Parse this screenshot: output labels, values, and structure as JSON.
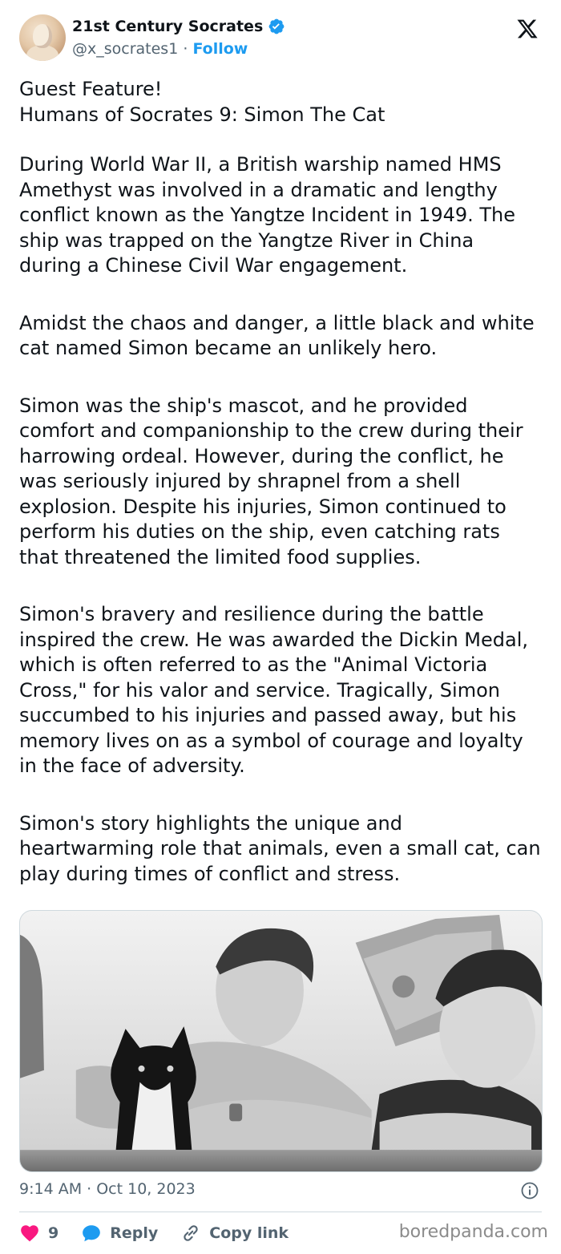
{
  "author": {
    "name": "21st Century Socrates",
    "handle": "@x_socrates1",
    "separator": "·",
    "follow_label": "Follow"
  },
  "post": {
    "paragraphs": [
      "Guest Feature!\nHumans of Socrates 9: Simon The Cat",
      "During World War II, a British warship named HMS Amethyst was involved in a dramatic and lengthy conflict known as the Yangtze Incident in 1949. The ship was trapped on the Yangtze River in China during a Chinese Civil War engagement.",
      "Amidst the chaos and danger, a little black and white cat named Simon became an unlikely hero.",
      "Simon was the ship's mascot, and he provided comfort and companionship to the crew during their harrowing ordeal. However, during the conflict, he was seriously injured by shrapnel from a shell explosion. Despite his injuries, Simon continued to perform his duties on the ship, even catching rats that threatened the limited food supplies.",
      "Simon's bravery and resilience during the battle inspired the crew. He was awarded the Dickin Medal, which is often referred to as the \"Animal Victoria Cross,\" for his valor and service. Tragically, Simon succumbed to his injuries and passed away, but his memory lives on as a symbol of courage and loyalty in the face of adversity.",
      "Simon's story highlights the unique and heartwarming role that animals, even a small cat, can play during times of conflict and stress."
    ],
    "timestamp": "9:14 AM · Oct 10, 2023"
  },
  "actions": {
    "like_count": "9",
    "reply_label": "Reply",
    "copy_label": "Copy link"
  },
  "watermark": "boredpanda.com",
  "colors": {
    "accent": "#1d9bf0",
    "like": "#f91880",
    "muted": "#536471",
    "text": "#0f1419"
  },
  "icons": [
    "verified-badge-icon",
    "x-logo-icon",
    "info-icon",
    "heart-icon",
    "reply-bubble-icon",
    "link-icon"
  ]
}
